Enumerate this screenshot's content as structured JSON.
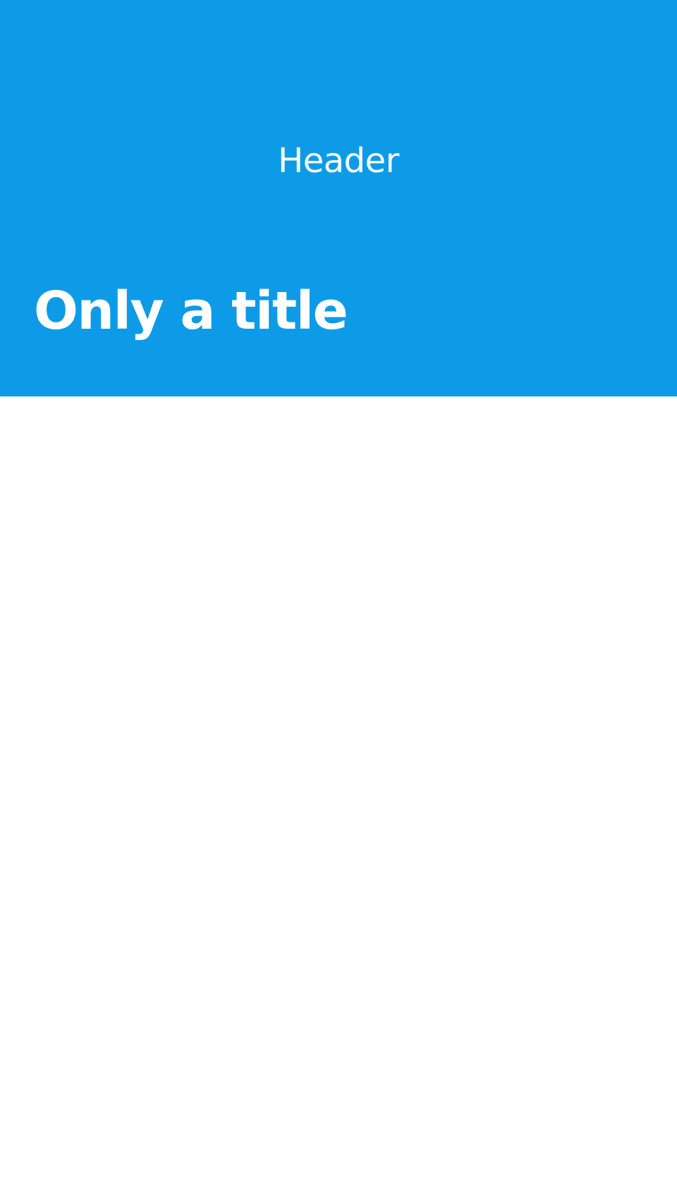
{
  "header": {
    "label": "Header",
    "title": "Only a title",
    "background_color": "#0d9be8",
    "text_color": "#ffffff"
  },
  "content": {
    "background_color": "#ffffff"
  }
}
